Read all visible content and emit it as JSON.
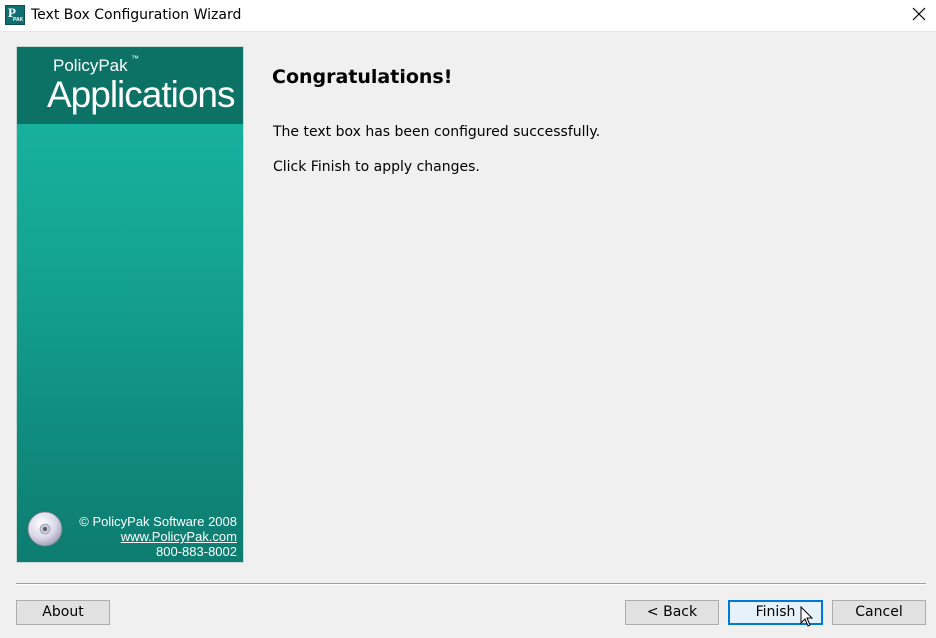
{
  "window": {
    "title": "Text Box Configuration Wizard",
    "icon": "policypak-app-icon",
    "icon_text_main": "P",
    "icon_text_sub": "PAK"
  },
  "banner": {
    "brand_name": "PolicyPak",
    "brand_tm": "™",
    "product": "Applications",
    "copyright": "© PolicyPak Software 2008",
    "url": "www.PolicyPak.com",
    "phone": "800-883-8002",
    "colors": {
      "header": "#0c7266",
      "gradient_top": "#19b7a4",
      "gradient_bottom": "#0e7c70"
    }
  },
  "content": {
    "heading": "Congratulations!",
    "message1": "The text box has been configured successfully.",
    "message2": "Click Finish to apply changes."
  },
  "buttons": {
    "about": "About",
    "back": "< Back",
    "finish": "Finish",
    "cancel": "Cancel"
  },
  "accent_color": "#0078d7"
}
